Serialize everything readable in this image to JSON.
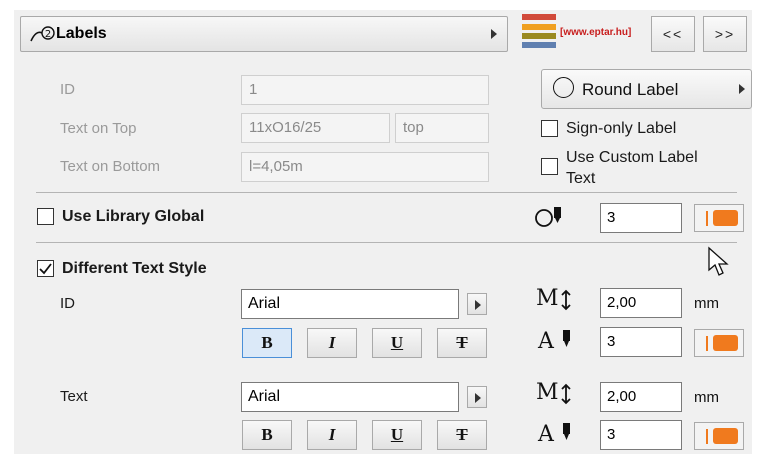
{
  "header": {
    "title": "Labels",
    "brand_text": "[www.eptar.hu]",
    "prev_label": "<<",
    "next_label": ">>"
  },
  "fields": {
    "id_label": "ID",
    "id_value": "1",
    "top_label": "Text on Top",
    "top_value1": "11xO16/25",
    "top_value2": "top",
    "bottom_label": "Text on Bottom",
    "bottom_value": "l=4,05m"
  },
  "options": {
    "round_label": "Round Label",
    "sign_only": "Sign-only Label",
    "custom_text_line1": "Use Custom Label",
    "custom_text_line2": "Text"
  },
  "library": {
    "label": "Use Library Global",
    "pen_value": "3"
  },
  "style": {
    "label": "Different Text Style",
    "id_row": {
      "label": "ID",
      "font": "Arial",
      "size": "2,00",
      "unit": "mm",
      "pen": "3"
    },
    "text_row": {
      "label": "Text",
      "font": "Arial",
      "size": "2,00",
      "unit": "mm",
      "pen": "3"
    },
    "bold": "B",
    "italic": "I",
    "underline": "U",
    "strike": "T"
  },
  "glyphs": {
    "size_glyph": "M",
    "pen_glyph": "A"
  },
  "colors": {
    "accent_orange": "#f07a1e",
    "active_blue": "#4a8fd8"
  }
}
